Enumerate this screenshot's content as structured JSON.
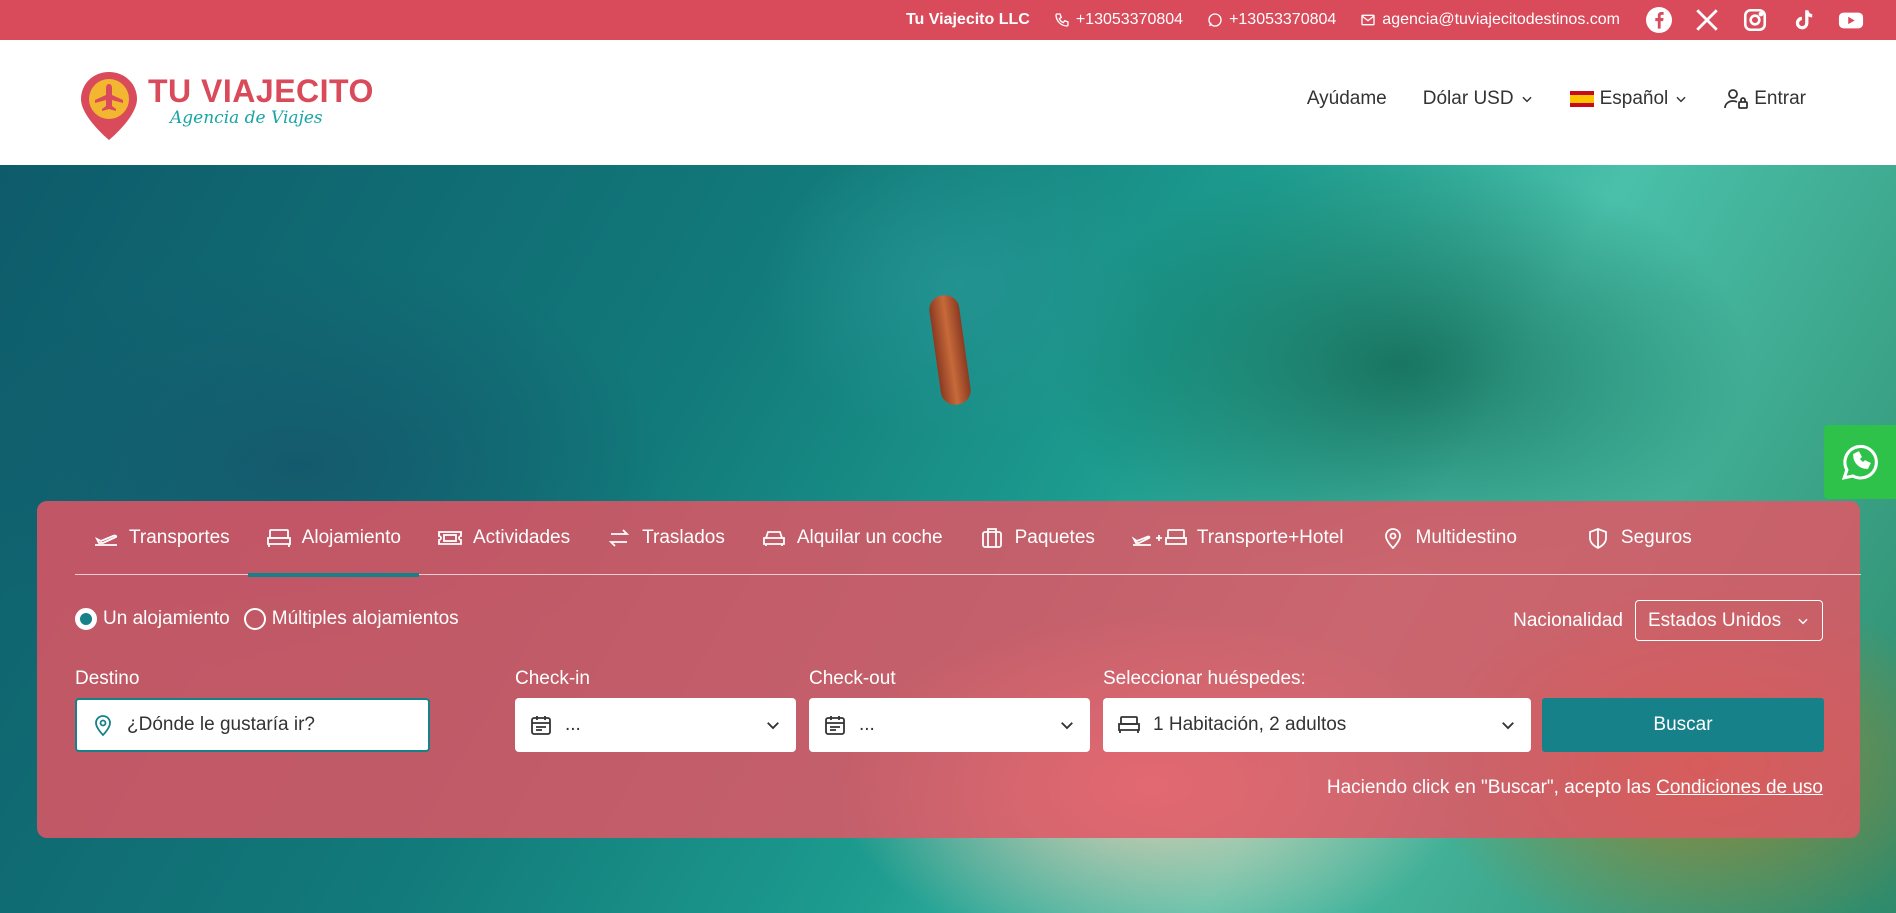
{
  "topbar": {
    "company": "Tu Viajecito LLC",
    "phone": "+13053370804",
    "whatsapp": "+13053370804",
    "email": "agencia@tuviajecitodestinos.com",
    "social_icons": [
      "facebook-icon",
      "x-twitter-icon",
      "instagram-icon",
      "tiktok-icon",
      "youtube-icon"
    ]
  },
  "header": {
    "logo_title": "TU VIAJECITO",
    "logo_subtitle": "Agencia de Viajes",
    "nav": {
      "help": "Ayúdame",
      "currency": "Dólar USD",
      "language": "Español",
      "login": "Entrar"
    }
  },
  "search": {
    "tabs": [
      {
        "label": "Transportes",
        "icon": "plane-icon"
      },
      {
        "label": "Alojamiento",
        "icon": "bed-icon",
        "active": true
      },
      {
        "label": "Actividades",
        "icon": "ticket-icon"
      },
      {
        "label": "Traslados",
        "icon": "transfer-arrows-icon"
      },
      {
        "label": "Alquilar un coche",
        "icon": "car-icon"
      },
      {
        "label": "Paquetes",
        "icon": "suitcase-icon"
      },
      {
        "label": "Transporte+Hotel",
        "icon": "plane-plus-bed-icon"
      },
      {
        "label": "Multidestino",
        "icon": "map-pin-icon"
      },
      {
        "label": "Seguros",
        "icon": "shield-icon"
      }
    ],
    "radio_single": "Un alojamiento",
    "radio_multiple": "Múltiples alojamientos",
    "nationality_label": "Nacionalidad",
    "nationality_value": "Estados Unidos",
    "destination_label": "Destino",
    "destination_placeholder": "¿Dónde le gustaría ir?",
    "checkin_label": "Check-in",
    "checkin_value": "...",
    "checkout_label": "Check-out",
    "checkout_value": "...",
    "guests_label": "Seleccionar huéspedes:",
    "guests_value": "1 Habitación, 2 adultos",
    "search_button": "Buscar",
    "terms_text": "Haciendo click en \"Buscar\", acepto las ",
    "terms_link": "Condiciones de uso"
  },
  "colors": {
    "brand_red": "#d94a5a",
    "teal": "#17818a",
    "whatsapp_green": "#2fc24a"
  }
}
